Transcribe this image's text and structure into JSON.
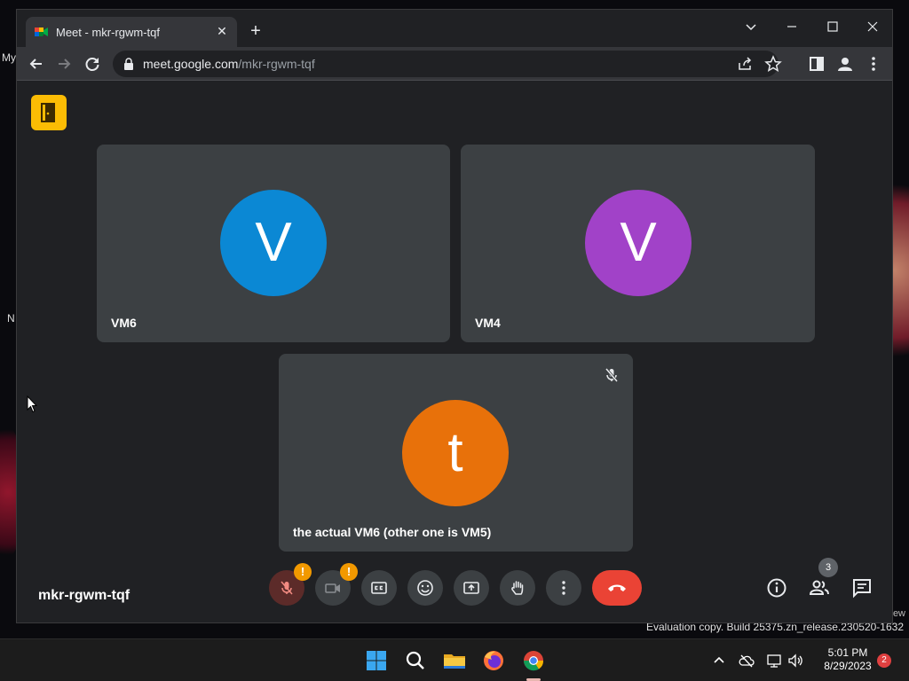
{
  "desktop": {
    "fragments": [
      "My",
      "N"
    ],
    "eval_fragment": "ew",
    "eval_text": "Evaluation copy. Build 25375.zn_release.230520-1632"
  },
  "browser": {
    "tab_title": "Meet - mkr-rgwm-tqf",
    "tab_close": "✕",
    "new_tab": "+",
    "url_host": "meet.google.com",
    "url_path": "/mkr-rgwm-tqf"
  },
  "meet": {
    "meeting_code": "mkr-rgwm-tqf",
    "participant_count": "3",
    "participants": [
      {
        "name": "VM6",
        "initial": "V",
        "color": "#0b88d4"
      },
      {
        "name": "VM4",
        "initial": "V",
        "color": "#a142c8"
      },
      {
        "name": "the actual VM6 (other one is VM5)",
        "initial": "t",
        "color": "#e8710a"
      }
    ],
    "warning_badge": "!",
    "colors": {
      "accent_yellow": "#fbbc04",
      "end_call_red": "#ea4335",
      "tile_bg": "#3c4043"
    }
  },
  "taskbar": {
    "time": "5:01 PM",
    "date": "8/29/2023",
    "notification_count": "2"
  }
}
